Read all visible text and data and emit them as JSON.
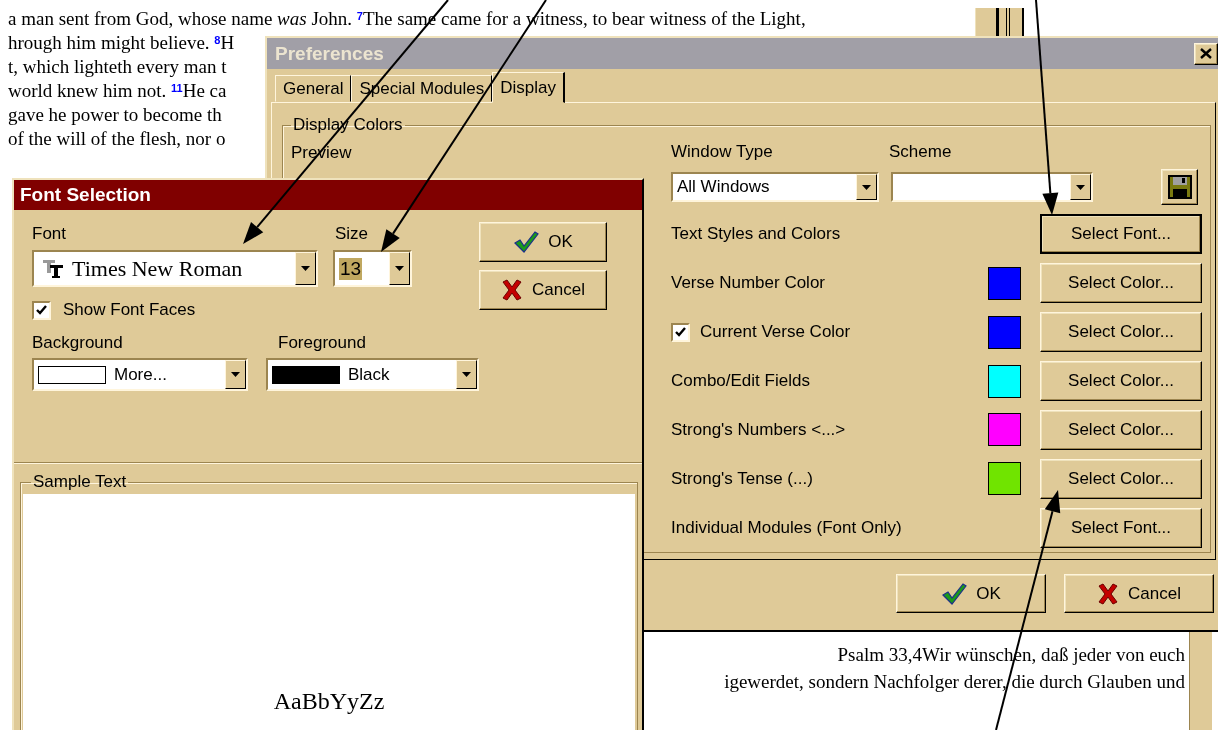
{
  "bible_text": {
    "lines": [
      [
        {
          "kind": "text",
          "text": "a man sent from God, whose name "
        },
        {
          "kind": "italic",
          "text": "was"
        },
        {
          "kind": "text",
          "text": " John. "
        },
        {
          "kind": "verse",
          "text": "7"
        },
        {
          "kind": "text",
          "text": "The same came for a witness, to bear witness of the Light,"
        }
      ],
      [
        {
          "kind": "text",
          "text": "hrough him might believe. "
        },
        {
          "kind": "verse",
          "text": "8"
        },
        {
          "kind": "text",
          "text": "H"
        }
      ],
      [
        {
          "kind": "text",
          "text": "t, which lighteth every man t"
        }
      ],
      [
        {
          "kind": "text",
          "text": "world knew him not. "
        },
        {
          "kind": "verse",
          "text": "11"
        },
        {
          "kind": "text",
          "text": "He ca"
        }
      ],
      [
        {
          "kind": "text",
          "text": "gave he power to become th"
        }
      ],
      [
        {
          "kind": "text",
          "text": "of the will of the flesh, nor o"
        }
      ]
    ]
  },
  "preferences": {
    "title": "Preferences",
    "tabs": [
      {
        "label": "General",
        "selected": false
      },
      {
        "label": "Special Modules",
        "selected": false
      },
      {
        "label": "Display",
        "selected": true
      }
    ],
    "group_label": "Display Colors",
    "preview_label": "Preview",
    "window_type": {
      "label": "Window Type",
      "value": "All Windows"
    },
    "scheme": {
      "label": "Scheme"
    },
    "rows": [
      {
        "kind": "font",
        "label": "Text Styles and Colors",
        "button": "Select Font...",
        "focused": true
      },
      {
        "kind": "color",
        "label": "Verse Number Color",
        "color": "#0000ff",
        "button": "Select Color...",
        "focused": false
      },
      {
        "kind": "check_color",
        "label": "Current Verse Color",
        "checked": true,
        "color": "#0000ff",
        "button": "Select Color...",
        "focused": false
      },
      {
        "kind": "color",
        "label": "Combo/Edit Fields",
        "color": "#00ffff",
        "button": "Select Color...",
        "focused": false
      },
      {
        "kind": "color",
        "label": "Strong's Numbers <...>",
        "color": "#ff00ff",
        "button": "Select Color...",
        "focused": false
      },
      {
        "kind": "color",
        "label": "Strong's Tense (...)",
        "color": "#70e400",
        "button": "Select Color...",
        "focused": false
      },
      {
        "kind": "font",
        "label": "Individual Modules (Font Only)",
        "button": "Select Font...",
        "focused": false
      }
    ],
    "buttons": [
      {
        "kind": "ok",
        "label": "OK"
      },
      {
        "kind": "cancel",
        "label": "Cancel"
      }
    ]
  },
  "preview_text": {
    "lines": [
      "Psalm 33,4Wir wünschen, daß jeder von euch",
      "igewerdet, sondern Nachfolger derer, die durch Glauben und"
    ]
  },
  "font_selection": {
    "title": "Font Selection",
    "font": {
      "label": "Font",
      "value": "Times New Roman"
    },
    "size": {
      "label": "Size",
      "value": "13",
      "highlighted": true
    },
    "show_font_faces": {
      "label": "Show Font Faces",
      "checked": true
    },
    "background": {
      "label": "Background",
      "value": "More...",
      "color": "#ffffff"
    },
    "foreground": {
      "label": "Foreground",
      "value": "Black",
      "color": "#000000"
    },
    "buttons": [
      {
        "kind": "ok",
        "label": "OK"
      },
      {
        "kind": "cancel",
        "label": "Cancel"
      }
    ],
    "sample": {
      "label": "Sample Text",
      "text": "AaBbYyZz"
    }
  }
}
